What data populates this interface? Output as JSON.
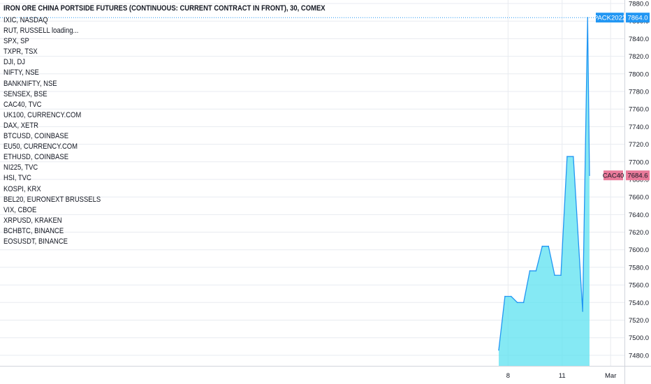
{
  "chart_title": "IRON ORE CHINA PORTSIDE FUTURES (CONTINUOUS: CURRENT CONTRACT IN FRONT), 30, COMEX",
  "symbol_list": [
    "IXIC, NASDAQ",
    "RUT, RUSSELL loading...",
    "SPX, SP",
    "TXPR, TSX",
    "DJI, DJ",
    "NIFTY, NSE",
    "BANKNIFTY, NSE",
    "SENSEX, BSE",
    "CAC40, TVC",
    "UK100, CURRENCY.COM",
    "DAX, XETR",
    "BTCUSD, COINBASE",
    "EU50, CURRENCY.COM",
    "ETHUSD, COINBASE",
    "NI225, TVC",
    "HSI, TVC",
    "KOSPI, KRX",
    "BEL20, EURONEXT BRUSSELS",
    "VIX, CBOE",
    "XRPUSD, KRAKEN",
    "BCHBTC, BINANCE",
    "EOSUSDT, BINANCE"
  ],
  "colors": {
    "line": "#2196f3",
    "area_fill": "#5ce1f0",
    "grid": "#e8ebf0",
    "pack_badge": "#2196f3",
    "cac_badge": "#e97a9a"
  },
  "chart_data": {
    "type": "area",
    "title": "IRON ORE CHINA PORTSIDE FUTURES (CONTINUOUS: CURRENT CONTRACT IN FRONT), 30, COMEX",
    "ylim": [
      7468,
      7884
    ],
    "yticks": [
      7880.0,
      7860.0,
      7840.0,
      7820.0,
      7800.0,
      7780.0,
      7760.0,
      7740.0,
      7720.0,
      7700.0,
      7680.0,
      7660.0,
      7640.0,
      7620.0,
      7600.0,
      7580.0,
      7560.0,
      7540.0,
      7520.0,
      7500.0,
      7480.0
    ],
    "xticks": [
      {
        "label": "8",
        "index": 1.5
      },
      {
        "label": "11",
        "index": 10.2
      },
      {
        "label": "Mar",
        "index": 18.0
      }
    ],
    "x_count": 21,
    "series": [
      {
        "values": [
          7486,
          7547,
          7547,
          7540,
          7540,
          7576,
          7576,
          7604,
          7604,
          7571,
          7571,
          7706,
          7706,
          7530,
          7864,
          7684.6
        ],
        "index": [
          0,
          1,
          2,
          3,
          4,
          5,
          6,
          7,
          8,
          9,
          10,
          11,
          12,
          13.5,
          14.3,
          14.6
        ]
      }
    ],
    "price_labels": [
      {
        "name": "PACK2022",
        "value": "7864.0",
        "level": 7864
      },
      {
        "name": "CAC40",
        "value": "7684.6",
        "level": 7684.6
      }
    ],
    "grid": true
  }
}
